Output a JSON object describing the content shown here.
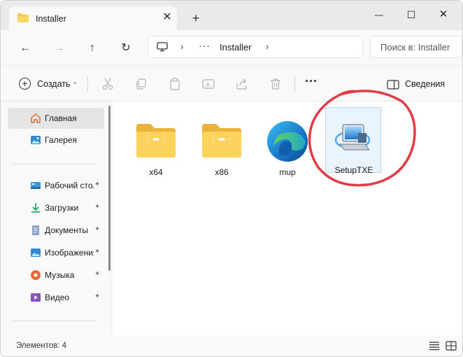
{
  "window": {
    "tab_title": "Installer",
    "tab_close_glyph": "✕",
    "tab_add_glyph": "+",
    "controls": {
      "minimize_glyph": "—",
      "maximize_glyph": "☐",
      "close_glyph": "✕"
    }
  },
  "navigation": {
    "back_glyph": "←",
    "forward_glyph": "→",
    "up_glyph": "↑",
    "refresh_glyph": "↻",
    "address": {
      "more_glyph": "···",
      "chevron_glyph": "›",
      "segment": "Installer"
    },
    "search_placeholder": "Поиск в: Installer"
  },
  "commandbar": {
    "create_label": "Создать",
    "create_chevron": "⌄",
    "more_glyph": "···",
    "details_label": "Сведения",
    "icons": [
      "cut-icon",
      "copy-icon",
      "paste-icon",
      "rename-icon",
      "share-icon",
      "delete-icon"
    ]
  },
  "sidebar": {
    "top_items": [
      {
        "label": "Главная",
        "icon": "home-icon",
        "selected": true
      },
      {
        "label": "Галерея",
        "icon": "gallery-icon"
      }
    ],
    "pinned_items": [
      {
        "label": "Рабочий стол",
        "icon": "desktop-icon"
      },
      {
        "label": "Загрузки",
        "icon": "download-icon"
      },
      {
        "label": "Документы",
        "icon": "documents-icon"
      },
      {
        "label": "Изображения",
        "icon": "pictures-icon"
      },
      {
        "label": "Музыка",
        "icon": "music-icon"
      },
      {
        "label": "Видео",
        "icon": "video-icon"
      }
    ],
    "pin_glyph": "📌"
  },
  "files": [
    {
      "name": "x64",
      "type": "folder"
    },
    {
      "name": "x86",
      "type": "folder"
    },
    {
      "name": "mup",
      "type": "edge"
    },
    {
      "name": "SetupTXE",
      "type": "setup",
      "selected": true
    }
  ],
  "statusbar": {
    "text": "Элементов: 4"
  },
  "colors": {
    "folder": "#f7c94b",
    "folder_dark": "#e9b23a",
    "accent": "#0067c0",
    "annotation": "#e33b45",
    "selection": "#eaf4fc"
  }
}
